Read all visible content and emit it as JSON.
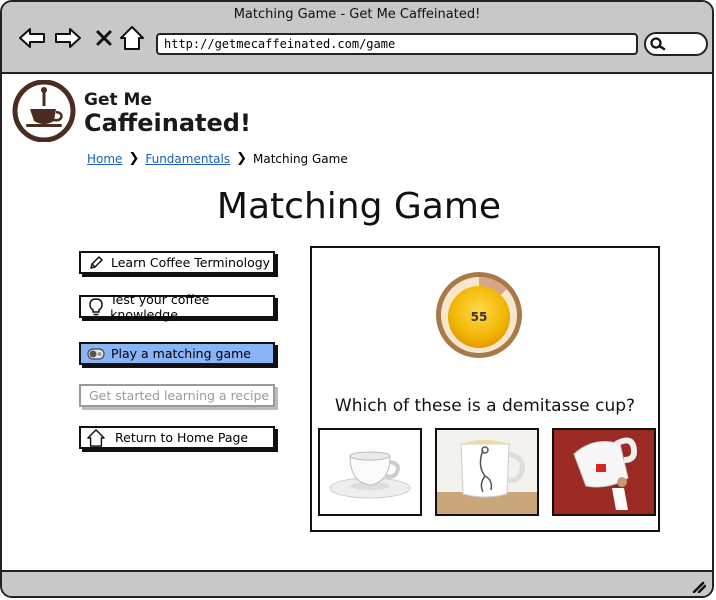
{
  "browser": {
    "title": "Matching Game - Get Me Caffeinated!",
    "url": "http://getmecaffeinated.com/game"
  },
  "brand": {
    "line1": "Get Me",
    "line2": "Caffeinated!"
  },
  "breadcrumb": {
    "home": "Home",
    "section": "Fundamentals",
    "current": "Matching Game"
  },
  "page_title": "Matching Game",
  "nav": [
    {
      "label": "Learn Coffee Terminology",
      "icon": "pencil-icon"
    },
    {
      "label": "Test your coffee knowledge",
      "icon": "lightbulb-icon"
    },
    {
      "label": "Play a matching game",
      "icon": "toggle-icon",
      "active": true
    },
    {
      "label": "Get started learning a recipe",
      "disabled": true
    },
    {
      "label": "Return to Home Page",
      "icon": "home-icon"
    }
  ],
  "game": {
    "timer_value": "55",
    "question": "Which of these is a demitasse cup?",
    "choices": [
      "demitasse-cup-image",
      "mug-image",
      "giant-cup-image"
    ]
  },
  "colors": {
    "active": "#8ab4f8",
    "link": "#1a5fb4",
    "timer": "#f2b705"
  }
}
